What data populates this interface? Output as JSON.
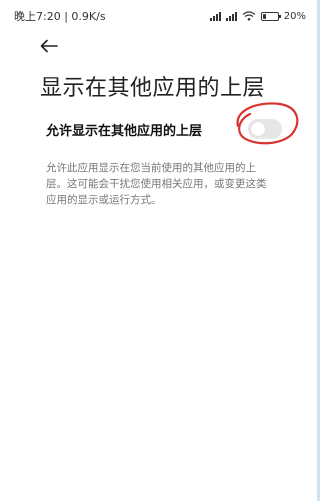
{
  "status_bar": {
    "time": "晚上7:20",
    "net_speed": "0.9K/s",
    "battery_percent": "20%",
    "battery_level": 0.2,
    "icons": [
      "signal-icon",
      "signal-icon",
      "wifi-icon",
      "battery-icon"
    ]
  },
  "header": {
    "back_icon": "arrow-left-icon",
    "title": "显示在其他应用的上层"
  },
  "setting": {
    "label": "允许显示在其他应用的上层",
    "enabled": false
  },
  "description": {
    "text": "允许此应用显示在您当前使用的其他应用的上层。这可能会干扰您使用相关应用，或变更这类应用的显示或运行方式。"
  },
  "colors": {
    "annotation_circle": "#d8332e",
    "toggle_off": "#e6e6e6"
  }
}
